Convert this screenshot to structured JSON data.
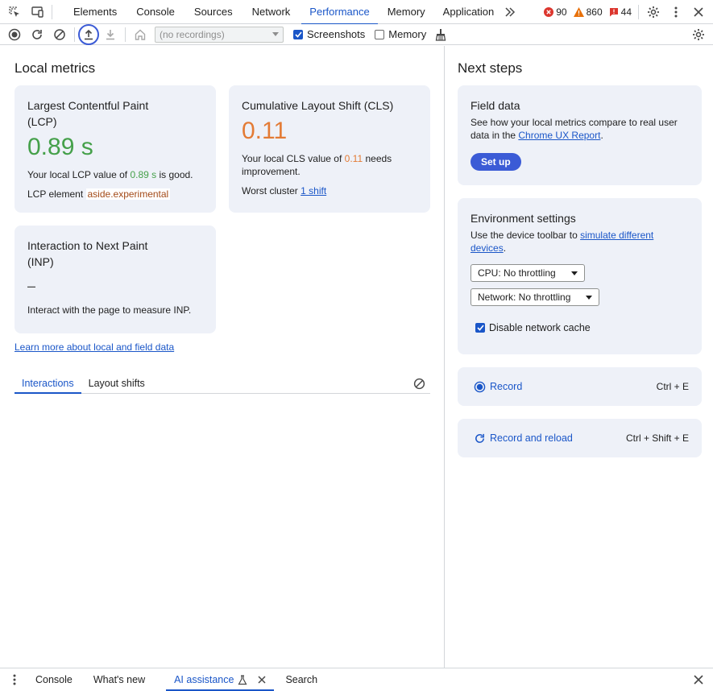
{
  "main_tabs": [
    "Elements",
    "Console",
    "Sources",
    "Network",
    "Performance",
    "Memory",
    "Application"
  ],
  "active_tab": "Performance",
  "counters": {
    "errors": "90",
    "warnings": "860",
    "issues": "44"
  },
  "toolbar": {
    "recordings_placeholder": "(no recordings)",
    "screenshots_label": "Screenshots",
    "screenshots_checked": true,
    "memory_label": "Memory",
    "memory_checked": false
  },
  "local_metrics": {
    "title": "Local metrics",
    "lcp": {
      "title_line1": "Largest Contentful Paint",
      "title_line2": "(LCP)",
      "value": "0.89 s",
      "desc_pre": "Your local LCP value of",
      "desc_value": "0.89 s",
      "desc_post": "is good.",
      "element_label": "LCP element",
      "element_value": "aside.experimental"
    },
    "cls": {
      "title": "Cumulative Layout Shift (CLS)",
      "value": "0.11",
      "desc_pre": "Your local CLS value of",
      "desc_value": "0.11",
      "desc_post_line1": "needs",
      "desc_post_line2": "improvement.",
      "worst_label": "Worst cluster",
      "worst_link": "1 shift"
    },
    "inp": {
      "title_line1": "Interaction to Next Paint",
      "title_line2": "(INP)",
      "value": "–",
      "desc": "Interact with the page to measure INP."
    },
    "learn_more": "Learn more about local and field data",
    "subtabs": [
      "Interactions",
      "Layout shifts"
    ]
  },
  "next_steps": {
    "title": "Next steps",
    "field_data": {
      "title": "Field data",
      "desc_line1": "See how your local metrics compare to real user",
      "desc_line2_pre": "data in the",
      "desc_link": "Chrome UX Report",
      "desc_line2_post": ".",
      "button": "Set up"
    },
    "environment": {
      "title": "Environment settings",
      "desc_pre": "Use the device toolbar to",
      "desc_link_line1": "simulate different",
      "desc_link_line2": "devices",
      "desc_post": ".",
      "cpu": "CPU: No throttling",
      "network": "Network: No throttling",
      "cache_label": "Disable network cache",
      "cache_checked": true
    },
    "record": {
      "label": "Record",
      "shortcut": "Ctrl + E"
    },
    "record_reload": {
      "label": "Record and reload",
      "shortcut": "Ctrl + Shift + E"
    }
  },
  "drawer": {
    "tabs": [
      "Console",
      "What's new",
      "AI assistance",
      "Search"
    ],
    "active": "AI assistance"
  },
  "colors": {
    "accent": "#1a56c8",
    "good": "#45a04a",
    "needs_improvement": "#e37b35",
    "card_bg": "#eef1f8"
  }
}
